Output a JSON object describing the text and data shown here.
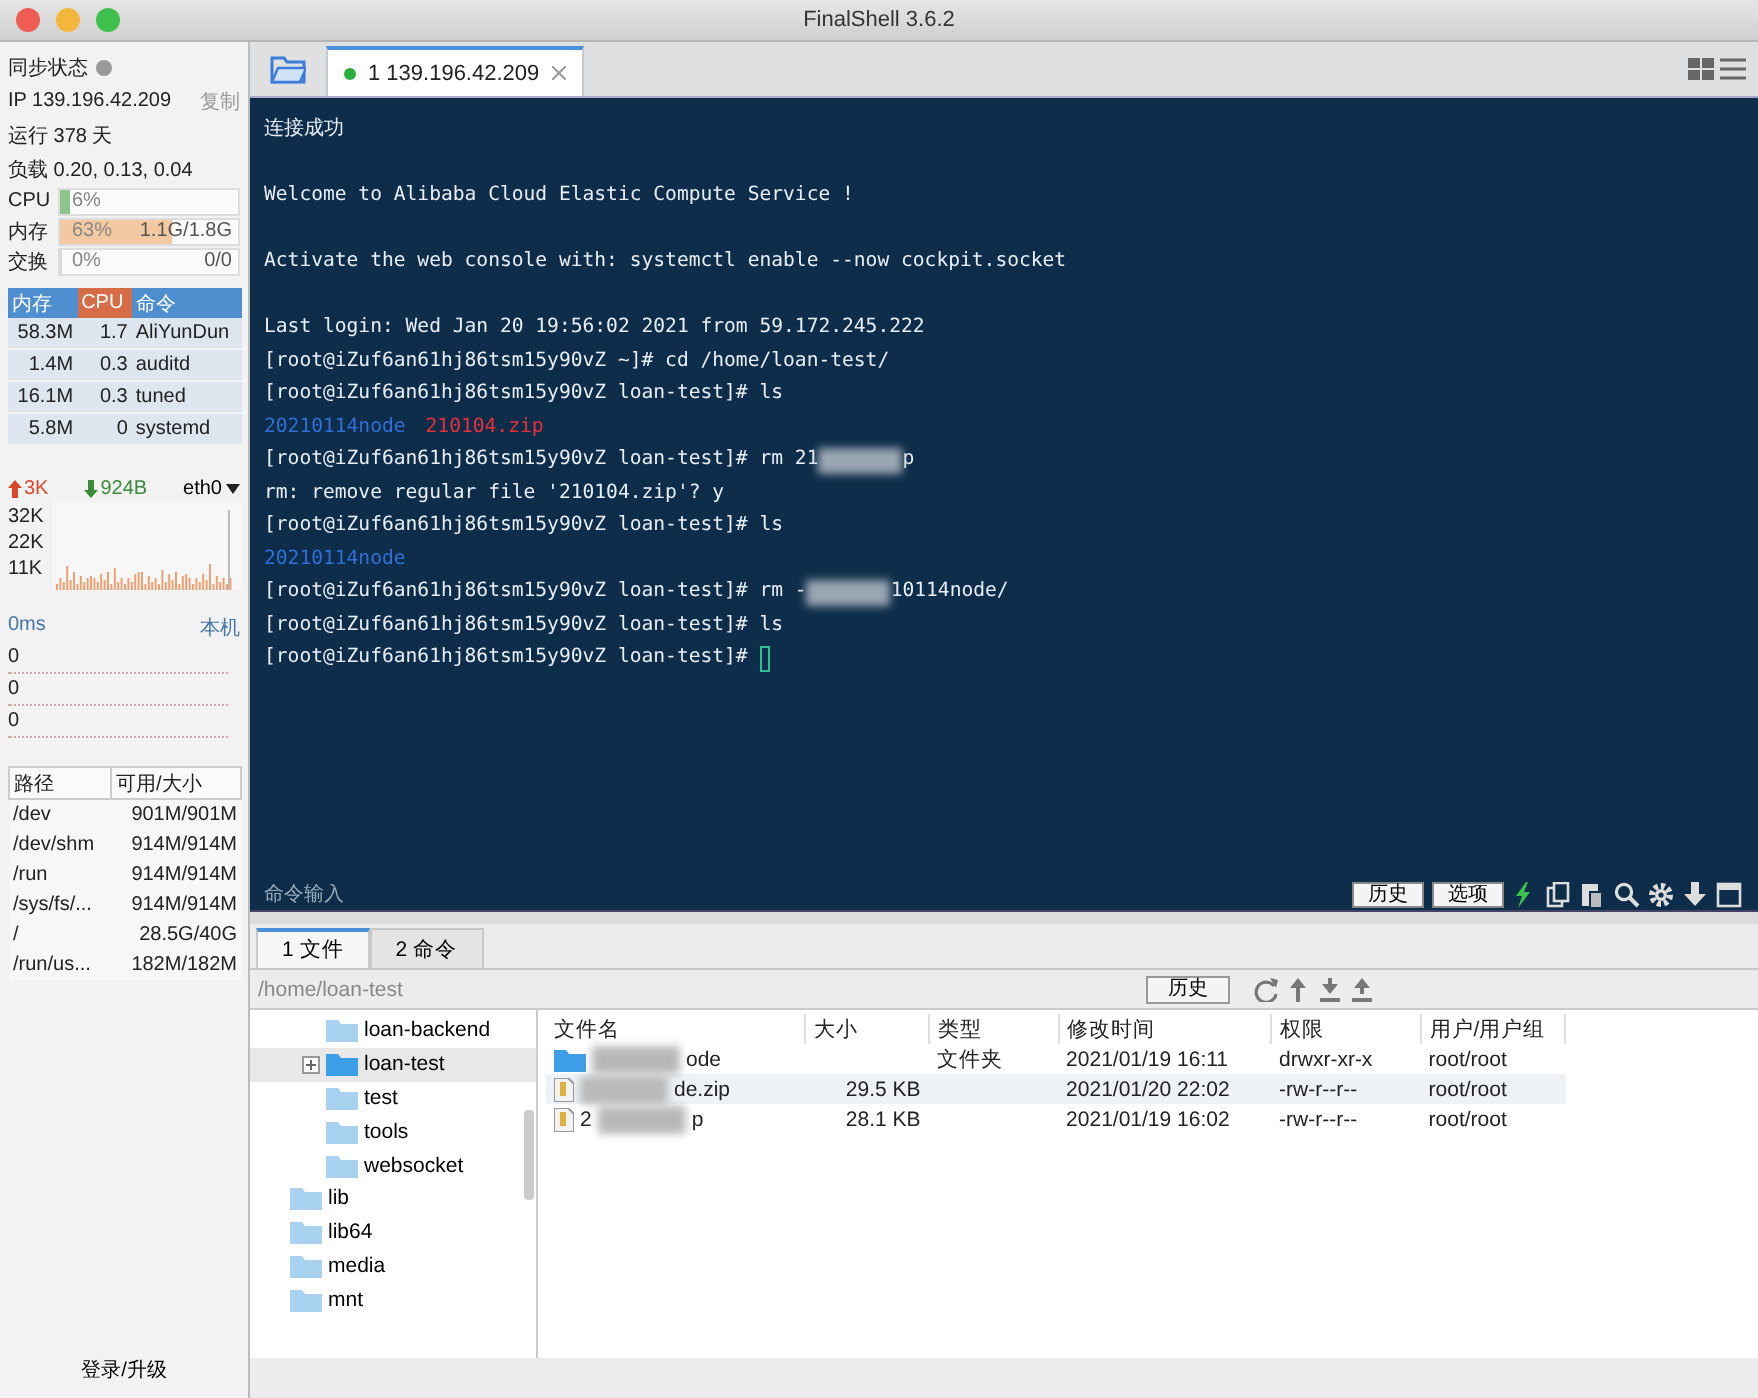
{
  "window": {
    "title": "FinalShell 3.6.2"
  },
  "sidebar": {
    "sync_label": "同步状态",
    "sync_on": false,
    "ip": "IP 139.196.42.209",
    "copy_button": "复制",
    "uptime": "运行 378 天",
    "load": "负载 0.20, 0.13, 0.04",
    "meters": [
      {
        "label": "CPU",
        "level": 0.06,
        "reading": "6%",
        "color": "#8cc48c"
      },
      {
        "label": "内存",
        "level": 0.63,
        "reading": "63%",
        "detail": "1.1G/1.8G",
        "color": "#f3c9a2"
      },
      {
        "label": "交换",
        "level": 0,
        "reading": "0%",
        "detail": "0/0"
      }
    ],
    "process_table": {
      "columns": [
        "内存",
        "CPU",
        "命令"
      ],
      "rows": [
        [
          "58.3M",
          "1.7",
          "AliYunDun"
        ],
        [
          "1.4M",
          "0.3",
          "auditd"
        ],
        [
          "16.1M",
          "0.3",
          "tuned"
        ],
        [
          "5.8M",
          "0",
          "systemd"
        ]
      ]
    },
    "network": {
      "upload": "3K",
      "download": "924B",
      "interface": "eth0",
      "axis_labels": [
        "32K",
        "22K",
        "11K"
      ]
    },
    "latency": {
      "label": "0ms",
      "host": "本机",
      "values": [
        "0",
        "0",
        "0"
      ]
    },
    "disks": {
      "columns": [
        "路径",
        "可用/大小"
      ],
      "rows": [
        [
          "/dev",
          "901M/901M"
        ],
        [
          "/dev/shm",
          "914M/914M"
        ],
        [
          "/run",
          "914M/914M"
        ],
        [
          "/sys/fs/...",
          "914M/914M"
        ],
        [
          "/",
          "28.5G/40G"
        ],
        [
          "/run/us...",
          "182M/182M"
        ]
      ]
    },
    "login_button": "登录/升级"
  },
  "tabs": [
    {
      "label": "1 139.196.42.209",
      "selected": true,
      "connected": true
    }
  ],
  "terminal": {
    "lines": [
      {
        "kind": "text",
        "segments": [
          {
            "kind": "plain",
            "text": "连接成功"
          }
        ]
      },
      {
        "kind": "blank"
      },
      {
        "kind": "text",
        "segments": [
          {
            "kind": "plain",
            "text": "Welcome to Alibaba Cloud Elastic Compute Service !"
          }
        ]
      },
      {
        "kind": "blank"
      },
      {
        "kind": "text",
        "segments": [
          {
            "kind": "plain",
            "text": "Activate the web console with: systemctl enable --now cockpit.socket"
          }
        ]
      },
      {
        "kind": "blank"
      },
      {
        "kind": "text",
        "segments": [
          {
            "kind": "plain",
            "text": "Last login: Wed Jan 20 19:56:02 2021 from 59.172.245.222"
          }
        ]
      },
      {
        "kind": "text",
        "segments": [
          {
            "kind": "plain",
            "text": "[root@iZuf6an61hj86tsm15y90vZ ~]# cd /home/loan-test/"
          }
        ]
      },
      {
        "kind": "text",
        "segments": [
          {
            "kind": "plain",
            "text": "[root@iZuf6an61hj86tsm15y90vZ loan-test]# ls"
          }
        ]
      },
      {
        "kind": "text",
        "segments": [
          {
            "kind": "dir",
            "text": "20210114node"
          },
          {
            "kind": "archive",
            "text": "210104.zip"
          }
        ]
      },
      {
        "kind": "text",
        "segments": [
          {
            "kind": "plain",
            "text": "[root@iZuf6an61hj86tsm15y90vZ loan-test]# rm 21"
          },
          {
            "kind": "redacted"
          },
          {
            "kind": "plain",
            "text": "p"
          }
        ]
      },
      {
        "kind": "text",
        "segments": [
          {
            "kind": "plain",
            "text": "rm: remove regular file '210104.zip'? y"
          }
        ]
      },
      {
        "kind": "text",
        "segments": [
          {
            "kind": "plain",
            "text": "[root@iZuf6an61hj86tsm15y90vZ loan-test]# ls"
          }
        ]
      },
      {
        "kind": "text",
        "segments": [
          {
            "kind": "dir",
            "text": "20210114node"
          }
        ]
      },
      {
        "kind": "text",
        "segments": [
          {
            "kind": "plain",
            "text": "[root@iZuf6an61hj86tsm15y90vZ loan-test]# rm -"
          },
          {
            "kind": "redacted"
          },
          {
            "kind": "plain",
            "text": "10114node/"
          }
        ]
      },
      {
        "kind": "text",
        "segments": [
          {
            "kind": "plain",
            "text": "[root@iZuf6an61hj86tsm15y90vZ loan-test]# ls"
          }
        ]
      },
      {
        "kind": "text",
        "segments": [
          {
            "kind": "plain",
            "text": "[root@iZuf6an61hj86tsm15y90vZ loan-test]# "
          },
          {
            "kind": "cursor"
          }
        ]
      }
    ],
    "input_placeholder": "命令输入",
    "buttons": [
      "历史",
      "选项"
    ]
  },
  "bottom_tabs": [
    {
      "label": "1 文件",
      "selected": true
    },
    {
      "label": "2 命令",
      "selected": false
    }
  ],
  "files": {
    "path": "/home/loan-test",
    "history_button": "历史",
    "tree": [
      {
        "children": [
          {
            "label": "loan-backend",
            "selected": false
          },
          {
            "label": "loan-test",
            "selected": true,
            "expandable": true
          },
          {
            "label": "test",
            "selected": false
          },
          {
            "label": "tools",
            "selected": false
          },
          {
            "label": "websocket",
            "selected": false
          }
        ]
      },
      {
        "label": "lib",
        "selected": false
      },
      {
        "label": "lib64",
        "selected": false
      },
      {
        "label": "media",
        "selected": false
      },
      {
        "label": "mnt",
        "selected": false
      }
    ],
    "columns": [
      "文件名",
      "大小",
      "类型",
      "修改时间",
      "权限",
      "用户/用户组"
    ],
    "rows": [
      {
        "kind": "folder",
        "selected": false,
        "name_tail": "ode",
        "type": "文件夹",
        "modified": "2021/01/19 16:11",
        "permissions": "drwxr-xr-x",
        "owner": "root/root"
      },
      {
        "kind": "archive",
        "selected": true,
        "name_tail": "de.zip",
        "size": "29.5 KB",
        "modified": "2021/01/20 22:02",
        "permissions": "-rw-r--r--",
        "owner": "root/root"
      },
      {
        "kind": "archive",
        "selected": false,
        "name_head": "2",
        "name_tail": "p",
        "size": "28.1 KB",
        "modified": "2021/01/19 16:02",
        "permissions": "-rw-r--r--",
        "owner": "root/root"
      }
    ]
  }
}
